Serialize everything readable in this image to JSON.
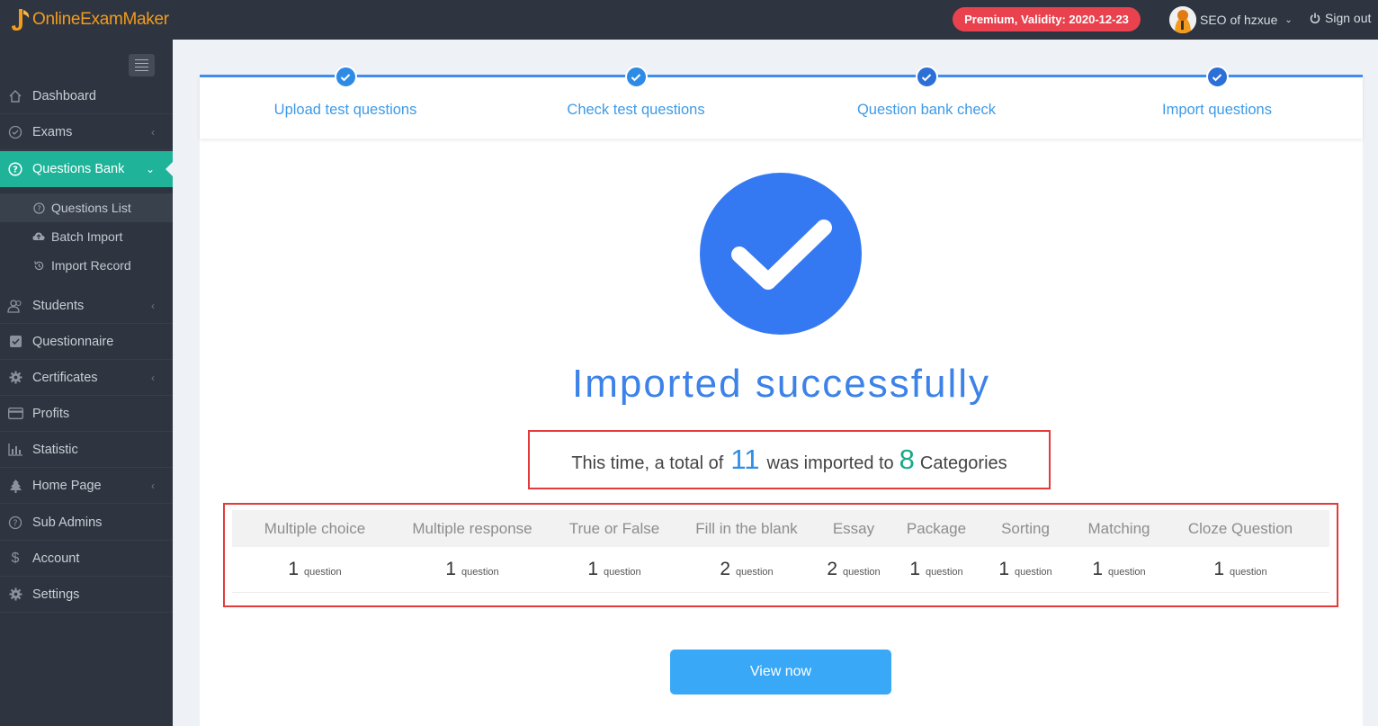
{
  "topbar": {
    "logo_text": "OnlineExamMaker",
    "premium_badge": "Premium, Validity: 2020-12-23",
    "user_name": "SEO of hzxue",
    "signout_label": "Sign out"
  },
  "sidebar": {
    "items": [
      {
        "label": "Dashboard",
        "icon": "home-icon"
      },
      {
        "label": "Exams",
        "icon": "check-circle-icon"
      },
      {
        "label": "Questions Bank",
        "icon": "question-circle-icon"
      },
      {
        "label": "Students",
        "icon": "users-icon"
      },
      {
        "label": "Questionnaire",
        "icon": "checkbox-icon"
      },
      {
        "label": "Certificates",
        "icon": "cog-icon"
      },
      {
        "label": "Profits",
        "icon": "credit-card-icon"
      },
      {
        "label": "Statistic",
        "icon": "bar-chart-icon"
      },
      {
        "label": "Home Page",
        "icon": "tree-icon"
      },
      {
        "label": "Sub Admins",
        "icon": "question-circle-icon"
      },
      {
        "label": "Account",
        "icon": "dollar-icon"
      },
      {
        "label": "Settings",
        "icon": "gear-icon"
      }
    ],
    "subitems": [
      {
        "label": "Questions List",
        "icon": "question-circle-icon"
      },
      {
        "label": "Batch Import",
        "icon": "cloud-upload-icon"
      },
      {
        "label": "Import Record",
        "icon": "history-icon"
      }
    ]
  },
  "steps": [
    {
      "label": "Upload test questions"
    },
    {
      "label": "Check test questions"
    },
    {
      "label": "Question bank check"
    },
    {
      "label": "Import questions"
    }
  ],
  "result": {
    "title": "Imported successfully",
    "summary_prefix": "This time, a total of",
    "total": "11",
    "summary_middle": "was imported to",
    "categories_count": "8",
    "summary_suffix": "Categories"
  },
  "table": {
    "headers": [
      "Multiple choice",
      "Multiple response",
      "True or False",
      "Fill in the blank",
      "Essay",
      "Package",
      "Sorting",
      "Matching",
      "Cloze Question"
    ],
    "counts": [
      "1",
      "1",
      "1",
      "2",
      "2",
      "1",
      "1",
      "1",
      "1"
    ],
    "unit": "question"
  },
  "view_button": "View now",
  "colors": {
    "accent": "#1fb49a",
    "primary_blue": "#3579f2",
    "premium_red": "#e9424e",
    "highlight_border": "#e33b3b"
  }
}
